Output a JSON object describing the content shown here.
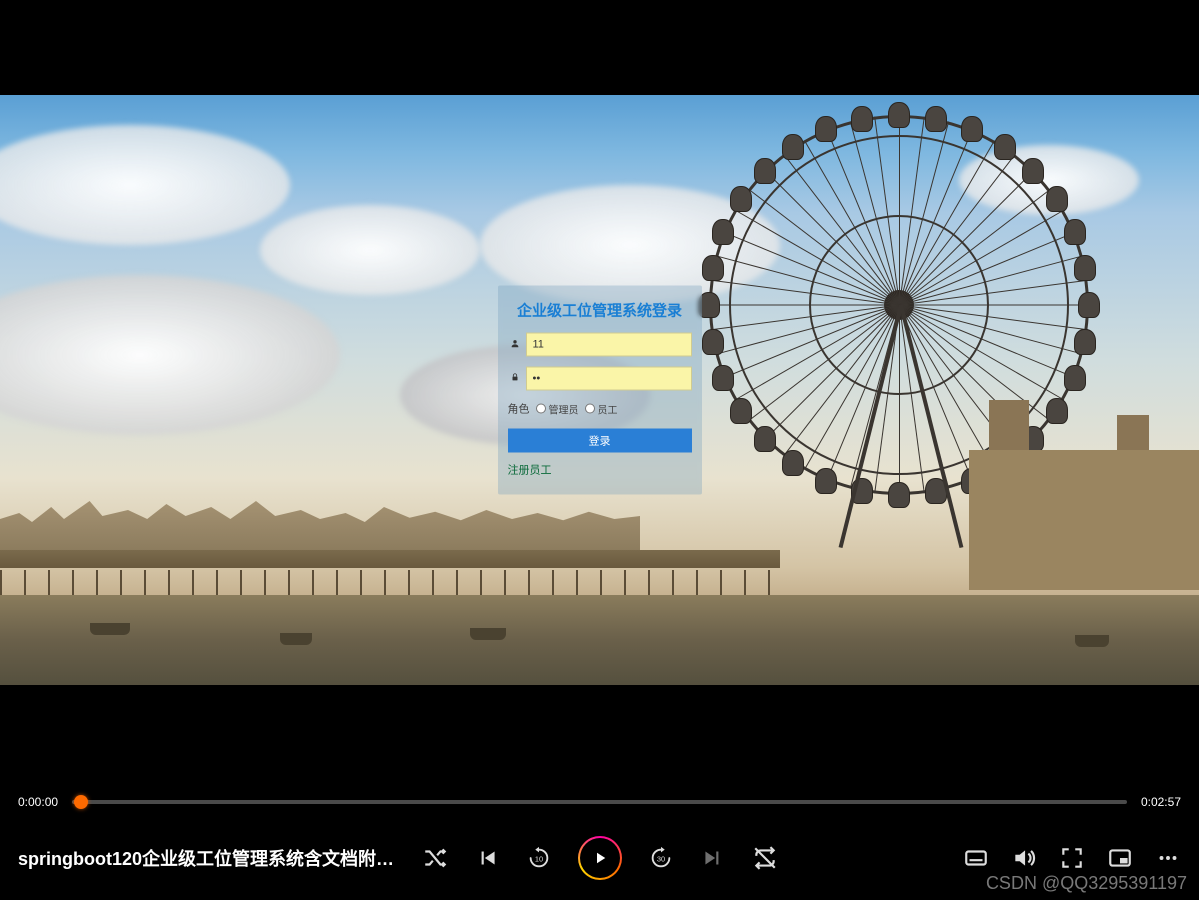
{
  "login": {
    "title": "企业级工位管理系统登录",
    "username": "11",
    "password": "••",
    "role_label": "角色",
    "role_admin": "管理员",
    "role_employee": "员工",
    "login_btn": "登录",
    "register_link": "注册员工"
  },
  "player": {
    "current_time": "0:00:00",
    "total_time": "0:02:57",
    "title": "springboot120企业级工位管理系统含文档附…",
    "skip_back": "10",
    "skip_forward": "30"
  },
  "watermark": "CSDN @QQ3295391197"
}
